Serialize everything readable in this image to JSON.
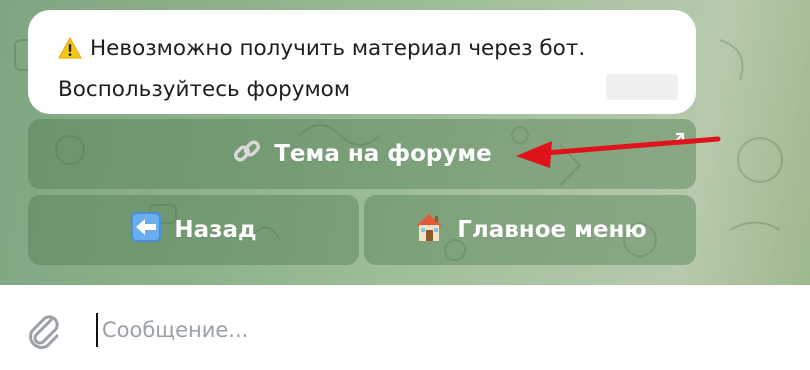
{
  "message": {
    "line1": "Невозможно получить материал через бот.",
    "line2": "Воспользуйтесь форумом",
    "warning_icon": "warning-icon"
  },
  "keyboard": {
    "forum_label": "Тема на форуме",
    "forum_icon": "link-icon",
    "back_label": "Назад",
    "back_icon": "back-arrow-icon",
    "menu_label": "Главное меню",
    "menu_icon": "house-icon"
  },
  "composer": {
    "placeholder": "Сообщение...",
    "attach_icon": "paperclip-icon"
  },
  "colors": {
    "accent_arrow": "#e0131b",
    "chat_background": "#8fb28d"
  }
}
